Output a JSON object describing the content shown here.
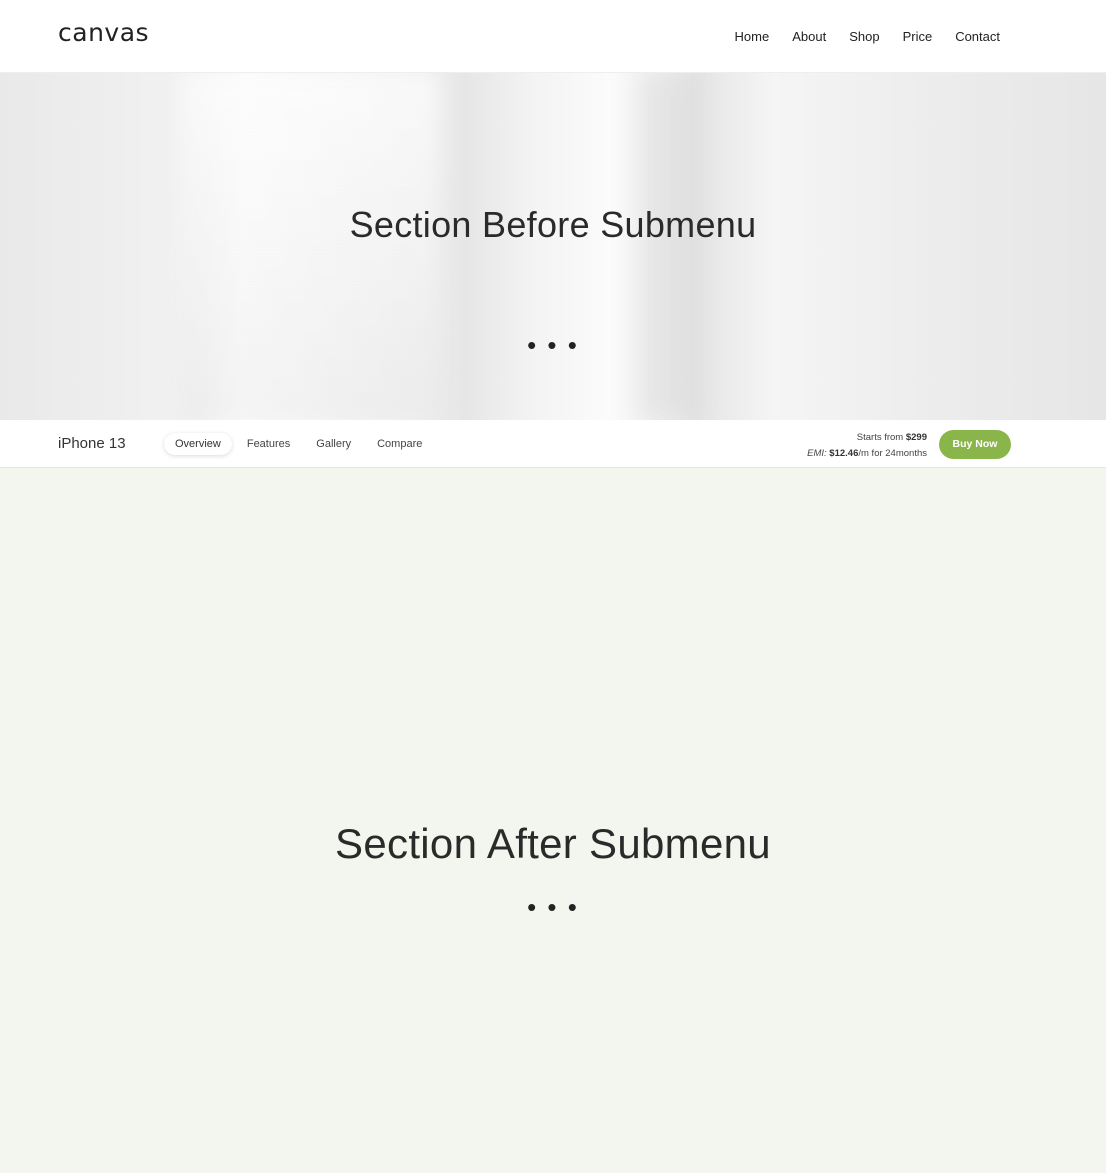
{
  "header": {
    "logo": "canvas",
    "nav": [
      "Home",
      "About",
      "Shop",
      "Price",
      "Contact"
    ]
  },
  "hero": {
    "title": "Section Before Submenu",
    "dots": "• • •"
  },
  "submenu": {
    "product": "iPhone 13",
    "items": [
      "Overview",
      "Features",
      "Gallery",
      "Compare"
    ],
    "active_item": "Overview",
    "price_line_prefix": "Starts from ",
    "price": "$299",
    "emi_label": "EMI: ",
    "emi_value": "$12.46",
    "emi_suffix": "/m for 24months",
    "buy_label": "Buy Now",
    "accent_color": "#8ab54b"
  },
  "after": {
    "title": "Section After Submenu",
    "dots": "• • •"
  }
}
